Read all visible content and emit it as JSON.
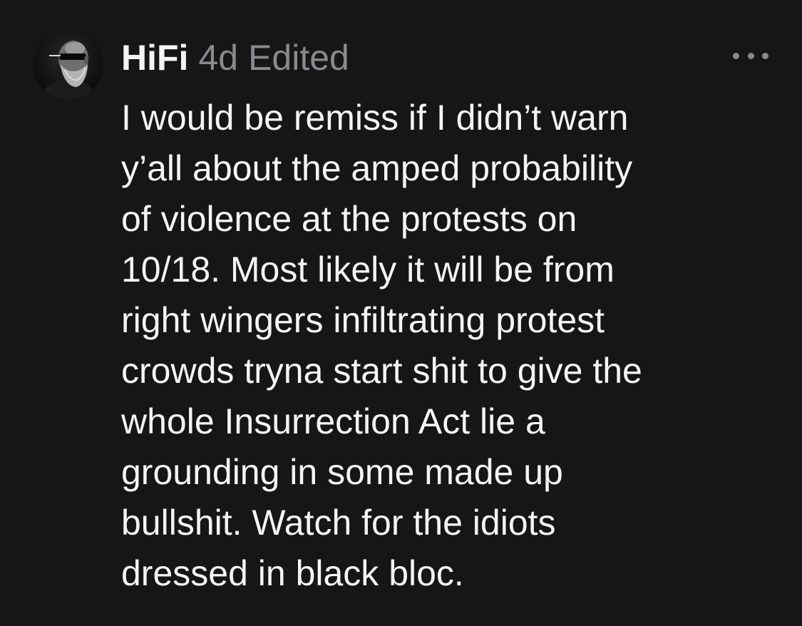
{
  "post": {
    "author": "HiFi",
    "age": "4d",
    "edited_label": "Edited",
    "more_icon": "ellipsis-icon",
    "avatar_icon": "user-avatar",
    "lines": [
      "I would be remiss if I didn’t warn",
      "y’all about the amped probability",
      "of violence at the protests on",
      "10/18. Most likely it will be from",
      "right wingers infiltrating protest",
      "crowds tryna start shit to give the",
      "whole Insurrection Act lie a",
      "grounding in some made up",
      "bullshit. Watch for the idiots",
      "dressed in black bloc."
    ]
  },
  "colors": {
    "background": "#161617",
    "text_primary": "#f4f4f4",
    "text_secondary": "#8a8a8e"
  }
}
